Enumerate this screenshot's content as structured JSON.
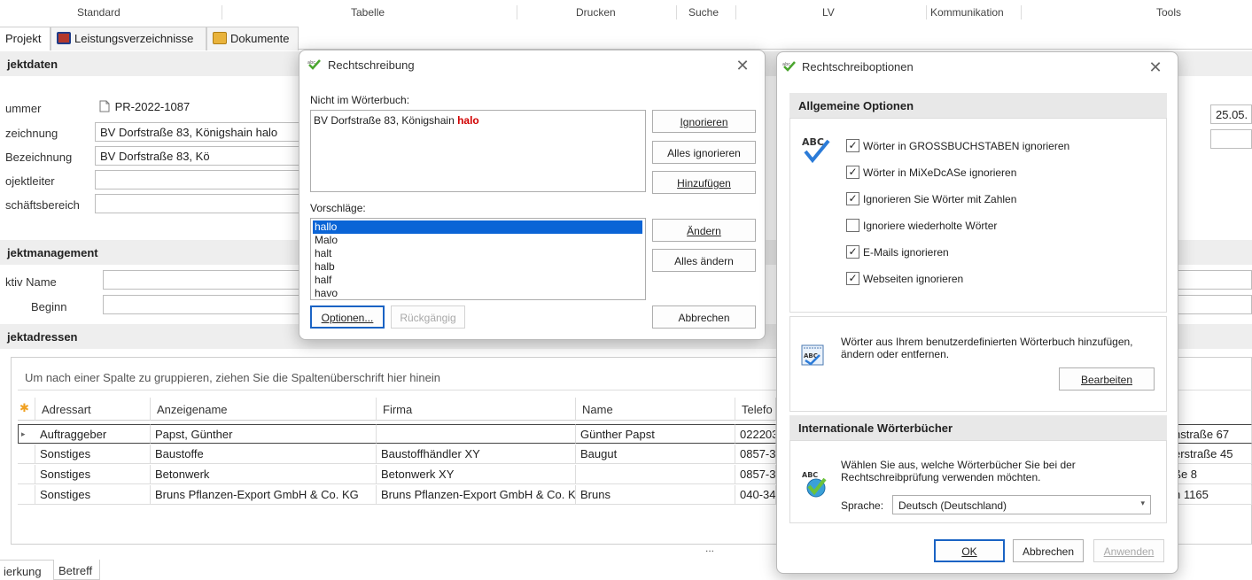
{
  "ribbon": {
    "groups": [
      "Standard",
      "Tabelle",
      "Drucken",
      "Suche",
      "LV",
      "Kommunikation",
      "Tools"
    ]
  },
  "doc_tabs": [
    {
      "label": "Projekt"
    },
    {
      "label": "Leistungsverzeichnisse"
    },
    {
      "label": "Dokumente"
    }
  ],
  "sections": {
    "projektdaten": "jektdaten",
    "management": "jektmanagement",
    "adressen": "jektadressen"
  },
  "form": {
    "labels": [
      "ummer",
      "zeichnung",
      "Bezeichnung",
      "ojektleiter",
      "schäftsbereich"
    ],
    "values": [
      "PR-2022-1087",
      "BV Dorfstraße 83, Königshain halo",
      "BV Dorfstraße 83, Kö",
      "",
      ""
    ],
    "management_labels": [
      "ktiv Name",
      "Beginn"
    ],
    "right_date": "25.05."
  },
  "grid": {
    "group_hint": "Um nach einer Spalte zu gruppieren, ziehen Sie die Spaltenüberschrift hier hinein",
    "headers": [
      "Adressart",
      "Anzeigename",
      "Firma",
      "Name",
      "Telefo"
    ],
    "rows": [
      [
        "Auftraggeber",
        "Papst, Günther",
        "",
        "Günther Papst",
        "022203"
      ],
      [
        "Sonstiges",
        "Baustoffe",
        "Baustoffhändler XY",
        "Baugut",
        "0857-3"
      ],
      [
        "Sonstiges",
        "Betonwerk",
        "Betonwerk XY",
        "",
        "0857-3"
      ],
      [
        "Sonstiges",
        "Bruns Pflanzen-Export GmbH & Co. KG",
        "Bruns Pflanzen-Export GmbH & Co. KG",
        "Bruns",
        "040-34"
      ]
    ],
    "right_col": [
      "hstraße 67",
      "erstraße 45",
      "ße 8",
      "h 1165"
    ],
    "ellipsis": "..."
  },
  "bottom_tabs": [
    "ierkung",
    "Betreff"
  ],
  "spell_dialog": {
    "title": "Rechtschreibung",
    "not_in_dict_label": "Nicht im Wörterbuch:",
    "sentence_prefix": "BV Dorfstraße 83, Königshain ",
    "misspelled": "halo",
    "suggestions_label": "Vorschläge:",
    "suggestions": [
      "hallo",
      "Malo",
      "halt",
      "halb",
      "half",
      "havo"
    ],
    "buttons": {
      "ignore": "Ignorieren",
      "ignore_all": "Alles ignorieren",
      "add": "Hinzufügen",
      "change": "Ändern",
      "change_all": "Alles ändern",
      "options": "Optionen...",
      "undo": "Rückgängig",
      "cancel": "Abbrechen"
    }
  },
  "options_dialog": {
    "title": "Rechtschreiboptionen",
    "general_header": "Allgemeine Optionen",
    "checkboxes": [
      {
        "label": "Wörter in GROSSBUCHSTABEN ignorieren",
        "checked": "✓"
      },
      {
        "label": "Wörter in MiXeDcASe ignorieren",
        "checked": "✓"
      },
      {
        "label": "Ignorieren Sie Wörter mit Zahlen",
        "checked": "✓"
      },
      {
        "label": "Ignoriere wiederholte Wörter",
        "checked": ""
      },
      {
        "label": "E-Mails ignorieren",
        "checked": "✓"
      },
      {
        "label": "Webseiten ignorieren",
        "checked": "✓"
      }
    ],
    "custom_dict_text": "Wörter aus Ihrem benutzerdefinierten Wörterbuch hinzufügen, ändern oder entfernen.",
    "edit_button": "Bearbeiten",
    "intl_header": "Internationale Wörterbücher",
    "intl_text": "Wählen Sie aus, welche Wörterbücher Sie bei der Rechtschreibprüfung verwenden möchten.",
    "language_label": "Sprache:",
    "language_value": "Deutsch (Deutschland)",
    "ok": "OK",
    "cancel": "Abbrechen",
    "apply": "Anwenden",
    "abc_text": "ABC"
  },
  "colors": {
    "misspelled": "#d10000",
    "selection": "#0a64d6",
    "check": "#2b7bd8"
  }
}
